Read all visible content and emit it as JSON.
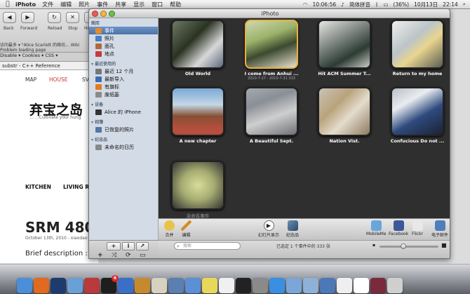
{
  "menubar": {
    "app": "iPhoto",
    "items": [
      "文件",
      "编辑",
      "照片",
      "事件",
      "共享",
      "显示",
      "窗口",
      "帮助"
    ],
    "input_method": "简体拼音",
    "battery": "(36%)",
    "date": "10月13日",
    "time_clock": "10:06:56",
    "time": "22:14"
  },
  "browser": {
    "nav": {
      "back": "Back",
      "forward": "Forward",
      "reload": "Reload",
      "stop": "Stop",
      "home": "Hom"
    },
    "bookmarks": "访问最多 ▾   \"Alice Scarlett 的络坊...   Wiki",
    "status": "Problem loading page",
    "tabs": "Disable ▾   Cookies ▾   CSS ▾",
    "active_tab": "substr - C++ Reference",
    "site": {
      "nav": [
        "MAP",
        "HOUSE",
        "SV"
      ],
      "title": "弃宝之岛",
      "subtitle": "… …Cultivate your hung",
      "categories": [
        "KITCHEN",
        "LIVING R"
      ],
      "post_title": "SRM 480",
      "post_date": "October 13th, 2010 - xiaodao",
      "post_brief": "Brief description :"
    }
  },
  "iphoto": {
    "title": "iPhoto",
    "sidebar": {
      "sections": [
        {
          "label": "图库",
          "items": [
            {
              "label": "事件",
              "icon": "events-icon",
              "color": "#e68a2e",
              "selected": true
            },
            {
              "label": "照片",
              "icon": "photos-icon",
              "color": "#4a7fc0",
              "selected": false
            },
            {
              "label": "面孔",
              "icon": "faces-icon",
              "color": "#b06a3a",
              "selected": false
            },
            {
              "label": "地点",
              "icon": "places-icon",
              "color": "#c43b3b",
              "selected": false
            }
          ]
        },
        {
          "label": "▾ 最近使用的",
          "items": [
            {
              "label": "最近 12 个月",
              "icon": "calendar-icon",
              "color": "#777",
              "selected": false
            },
            {
              "label": "最新导入",
              "icon": "import-icon",
              "color": "#3b6cb0",
              "selected": false
            },
            {
              "label": "有旗标",
              "icon": "flag-icon",
              "color": "#e07b1f",
              "selected": false
            },
            {
              "label": "废纸篓",
              "icon": "trash-icon",
              "color": "#8a8a8a",
              "selected": false
            }
          ]
        },
        {
          "label": "▾ 设备",
          "items": [
            {
              "label": "Alice 的 iPhone",
              "icon": "iphone-icon",
              "color": "#333",
              "selected": false
            }
          ]
        },
        {
          "label": "▾ 相簿",
          "items": [
            {
              "label": "已恢复的照片",
              "icon": "album-icon",
              "color": "#5177a8",
              "selected": false
            }
          ]
        },
        {
          "label": "▾ 纪念品",
          "items": [
            {
              "label": "未命名的日历",
              "icon": "calendar-project-icon",
              "color": "#888",
              "selected": false
            }
          ]
        }
      ],
      "buttons": [
        "+",
        "i",
        "↗"
      ],
      "bottom_icons": [
        "+",
        "⤨",
        "⟳",
        "▭"
      ]
    },
    "events": [
      {
        "name": "Old World",
        "date": "",
        "style": "ph-a",
        "selected": false
      },
      {
        "name": "I come from Anhui ...",
        "date": "2010-7-27 - 2010-7-31  333",
        "style": "ph-b",
        "selected": true
      },
      {
        "name": "Hit ACM Summer T...",
        "date": "",
        "style": "ph-c",
        "selected": false
      },
      {
        "name": "Return to my home",
        "date": "",
        "style": "ph-d",
        "selected": false
      },
      {
        "name": "A new chapter",
        "date": "",
        "style": "ph-e",
        "selected": false
      },
      {
        "name": "A Beautiful Sept.",
        "date": "",
        "style": "ph-f",
        "selected": false
      },
      {
        "name": "Nation Vist.",
        "date": "",
        "style": "ph-g",
        "selected": false
      },
      {
        "name": "Confucious Do not ...",
        "date": "",
        "style": "ph-h",
        "selected": false
      },
      {
        "name": "未命名事件",
        "date": "",
        "style": "ph-i",
        "selected": false
      }
    ],
    "toolbar": {
      "merge": "合并",
      "edit": "编辑",
      "slideshow": "幻灯片显示",
      "keepsakes": "纪念品",
      "share": [
        {
          "label": "MobileMe",
          "icon": "mobileme-icon",
          "color": "#6aa5dc"
        },
        {
          "label": "Facebook",
          "icon": "facebook-icon",
          "color": "#3b5998"
        },
        {
          "label": "Flickr",
          "icon": "flickr-icon",
          "color": "#e8e8e8"
        },
        {
          "label": "电子邮件",
          "icon": "email-icon",
          "color": "#4f7fba"
        }
      ]
    },
    "status": {
      "search_placeholder": "搜索",
      "selection_text": "已选定 1 个事件中的 333 张",
      "zoom": 0.4
    }
  },
  "dock": {
    "items": [
      {
        "icon": "finder-icon",
        "color": "#4a8fd8"
      },
      {
        "icon": "firefox-icon",
        "color": "#e06a1f"
      },
      {
        "icon": "photoshop-icon",
        "color": "#1d3b6c"
      },
      {
        "icon": "iphoto-icon",
        "color": "#6aa0d6"
      },
      {
        "icon": "photo-booth-icon",
        "color": "#b83a3a"
      },
      {
        "icon": "qq-icon",
        "color": "#1e1e1e"
      },
      {
        "icon": "itunes-icon",
        "color": "#3a6fc8"
      },
      {
        "icon": "guitar-icon",
        "color": "#c68a2e"
      },
      {
        "icon": "wine-icon",
        "color": "#d7d1c2"
      },
      {
        "icon": "preview-icon",
        "color": "#5a7fb0"
      },
      {
        "icon": "xcode-icon",
        "color": "#5b8fd6"
      },
      {
        "icon": "stickies-icon",
        "color": "#e8d85a"
      },
      {
        "icon": "textedit-icon",
        "color": "#f0f0f0"
      },
      {
        "icon": "terminal-icon",
        "color": "#222222"
      },
      {
        "icon": "system-preferences-icon",
        "color": "#8a8a8a"
      },
      {
        "icon": "safari-icon",
        "color": "#3a8fe0"
      },
      {
        "icon": "mail-icon",
        "color": "#7aa6d8"
      },
      {
        "icon": "folder-icon",
        "color": "#8fb1d8"
      },
      {
        "icon": "downloads-icon",
        "color": "#4d78b8"
      },
      {
        "icon": "document-icon",
        "color": "#efefef"
      },
      {
        "icon": "window-thumbnail-icon",
        "color": "#ffffff"
      },
      {
        "icon": "image-thumbnail-icon",
        "color": "#7a2a3a"
      },
      {
        "icon": "trash-icon",
        "color": "#cfcfcf"
      }
    ],
    "badge": "6"
  }
}
